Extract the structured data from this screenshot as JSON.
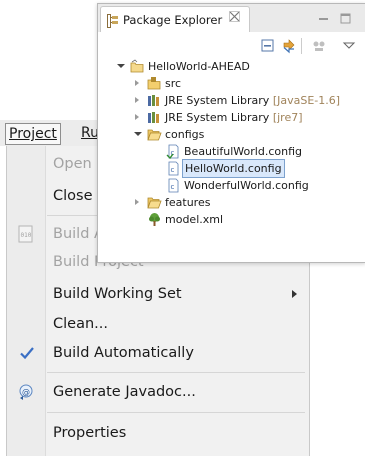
{
  "menubar": {
    "project_label": "Project",
    "run_label": "Ru"
  },
  "project_menu": {
    "items": [
      {
        "label": "Open Project",
        "enabled": false
      },
      {
        "label": "Close Project",
        "enabled": true
      },
      {
        "label": "Build All",
        "enabled": false,
        "icon": "binary-build-icon"
      },
      {
        "label": "Build Project",
        "enabled": false
      },
      {
        "label": "Build Working Set",
        "enabled": true,
        "submenu": true
      },
      {
        "label": "Clean...",
        "enabled": true
      },
      {
        "label": "Build Automatically",
        "enabled": true,
        "checked": true,
        "icon": "checkmark-icon"
      },
      {
        "label": "Generate Javadoc...",
        "enabled": true,
        "icon": "javadoc-icon"
      },
      {
        "label": "Properties",
        "enabled": true
      }
    ]
  },
  "package_explorer": {
    "tab_label": "Package Explorer",
    "tab_close": "⌦",
    "tree": [
      {
        "label": "HelloWorld-AHEAD",
        "depth": 0,
        "state": "open",
        "icon": "project-folder-icon"
      },
      {
        "label": "src",
        "depth": 1,
        "state": "closed",
        "icon": "source-folder-icon"
      },
      {
        "label": "JRE System Library",
        "decor": "[JavaSE-1.6]",
        "depth": 1,
        "state": "closed",
        "icon": "library-icon"
      },
      {
        "label": "JRE System Library",
        "decor": "[jre7]",
        "depth": 1,
        "state": "closed",
        "icon": "library-icon"
      },
      {
        "label": "configs",
        "depth": 1,
        "state": "open",
        "icon": "folder-open-icon"
      },
      {
        "label": "BeautifulWorld.config",
        "depth": 2,
        "state": "leaf",
        "icon": "config-file-icon"
      },
      {
        "label": "HelloWorld.config",
        "depth": 2,
        "state": "leaf",
        "icon": "config-file-icon",
        "selected": true
      },
      {
        "label": "WonderfulWorld.config",
        "depth": 2,
        "state": "leaf",
        "icon": "config-file-icon"
      },
      {
        "label": "features",
        "depth": 1,
        "state": "closed",
        "icon": "folder-icon"
      },
      {
        "label": "model.xml",
        "depth": 1,
        "state": "leaf",
        "icon": "model-tree-icon"
      }
    ]
  },
  "colors": {
    "selection_fill": "#d9e8fb",
    "selection_border": "#7da2ce",
    "disabled_text": "#a3a3a3",
    "decoration_text": "#a0835a",
    "check_blue": "#3a6fc4"
  }
}
